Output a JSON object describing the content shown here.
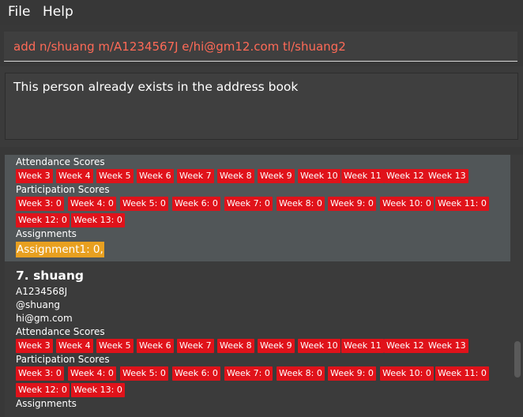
{
  "menu": {
    "file": "File",
    "help": "Help"
  },
  "command": {
    "value": "add n/shuang m/A1234567J e/hi@gm12.com tl/shuang2"
  },
  "result": {
    "message": "This person already exists in the address book"
  },
  "labels": {
    "attendance": "Attendance Scores",
    "participation": "Participation Scores",
    "assignments": "Assignments"
  },
  "person_prev": {
    "attendance": [
      "Week 3",
      "Week 4",
      "Week 5",
      "Week 6",
      "Week 7",
      "Week 8",
      "Week 9",
      "Week 10",
      "Week 11",
      "Week 12",
      "Week 13"
    ],
    "participation": [
      "Week 3: 0",
      "Week 4: 0",
      "Week 5: 0",
      "Week 6: 0",
      "Week 7: 0",
      "Week 8: 0",
      "Week 9: 0",
      "Week 10: 0",
      "Week 11: 0",
      "Week 12: 0",
      "Week 13: 0"
    ],
    "assignment": "Assignment1: 0,"
  },
  "person7": {
    "index_name": "7.  shuang",
    "matric": "A1234568J",
    "telegram": "@shuang",
    "email": "hi@gm.com",
    "attendance": [
      "Week 3",
      "Week 4",
      "Week 5",
      "Week 6",
      "Week 7",
      "Week 8",
      "Week 9",
      "Week 10",
      "Week 11",
      "Week 12",
      "Week 13"
    ],
    "participation": [
      "Week 3: 0",
      "Week 4: 0",
      "Week 5: 0",
      "Week 6: 0",
      "Week 7: 0",
      "Week 8: 0",
      "Week 9: 0",
      "Week 10: 0",
      "Week 11: 0",
      "Week 12: 0",
      "Week 13: 0"
    ]
  },
  "colors": {
    "tag_red": "#e0121a",
    "assignment_orange": "#e8a020",
    "command_text": "#ff6a57"
  }
}
